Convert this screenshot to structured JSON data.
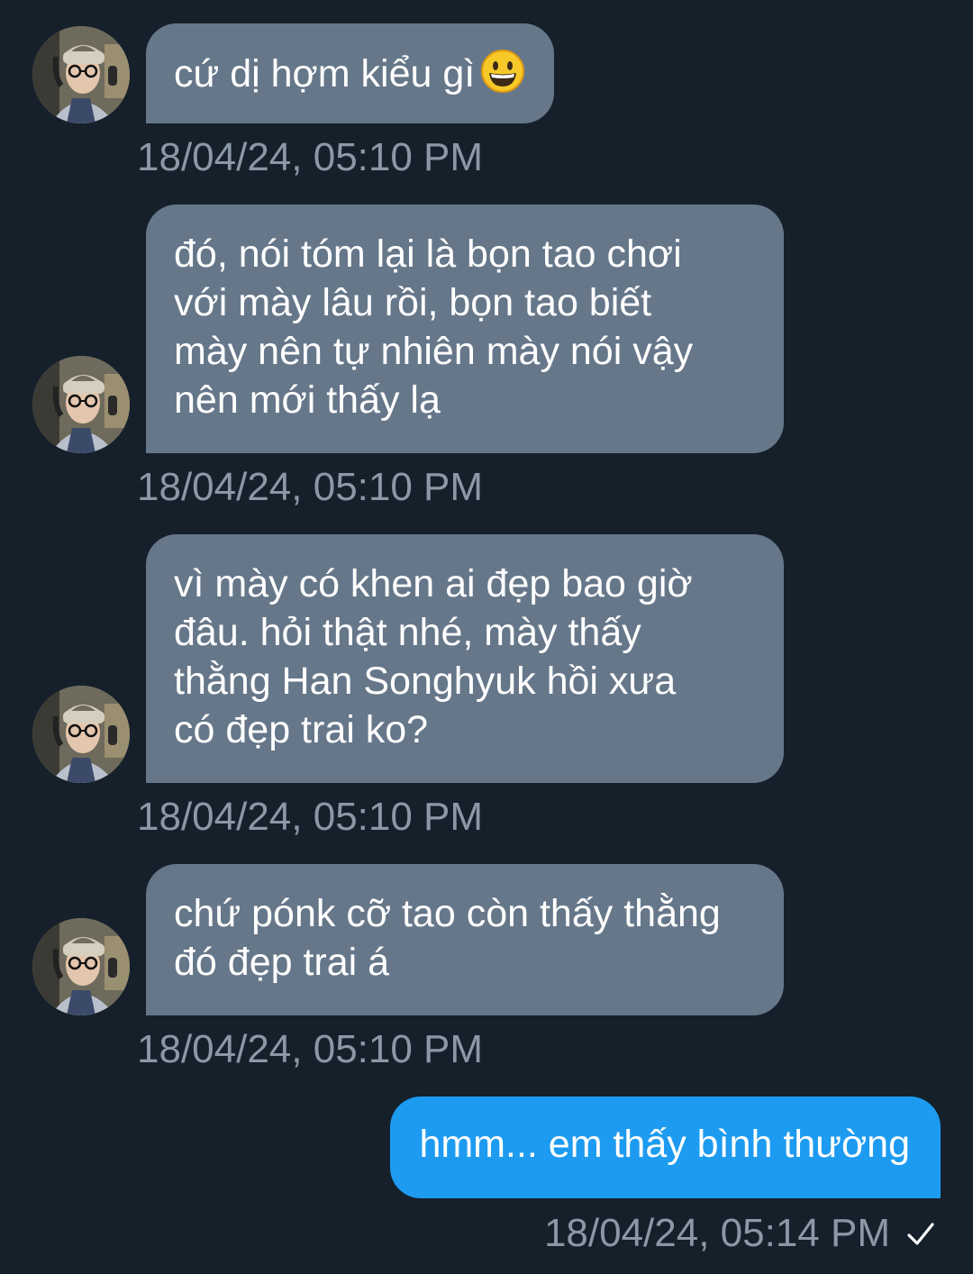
{
  "messages": [
    {
      "text": "cứ dị hợm kiểu gì",
      "emoji": "grinning-face",
      "time": "18/04/24, 05:10 PM"
    },
    {
      "text": "đó, nói tóm lại là bọn tao chơi\nvới mày lâu rồi, bọn tao biết\nmày nên tự nhiên mày nói vậy\nnên mới thấy lạ",
      "time": "18/04/24, 05:10 PM"
    },
    {
      "text": "vì mày có khen ai đẹp bao giờ\nđâu. hỏi thật nhé, mày thấy\nthằng Han Songhyuk hồi xưa\ncó đẹp trai ko?",
      "time": "18/04/24, 05:10 PM"
    },
    {
      "text": "chứ pónk cỡ tao còn thấy thằng\nđó đẹp trai á",
      "time": "18/04/24, 05:10 PM"
    }
  ],
  "sent_message": {
    "text": "hmm... em thấy bình thường",
    "time": "18/04/24, 05:14 PM",
    "status_icon": "check-icon"
  },
  "colors": {
    "background": "#15202b",
    "received_bubble": "#66778a",
    "sent_bubble": "#1d9bf0",
    "timestamp": "#8b98a5"
  }
}
